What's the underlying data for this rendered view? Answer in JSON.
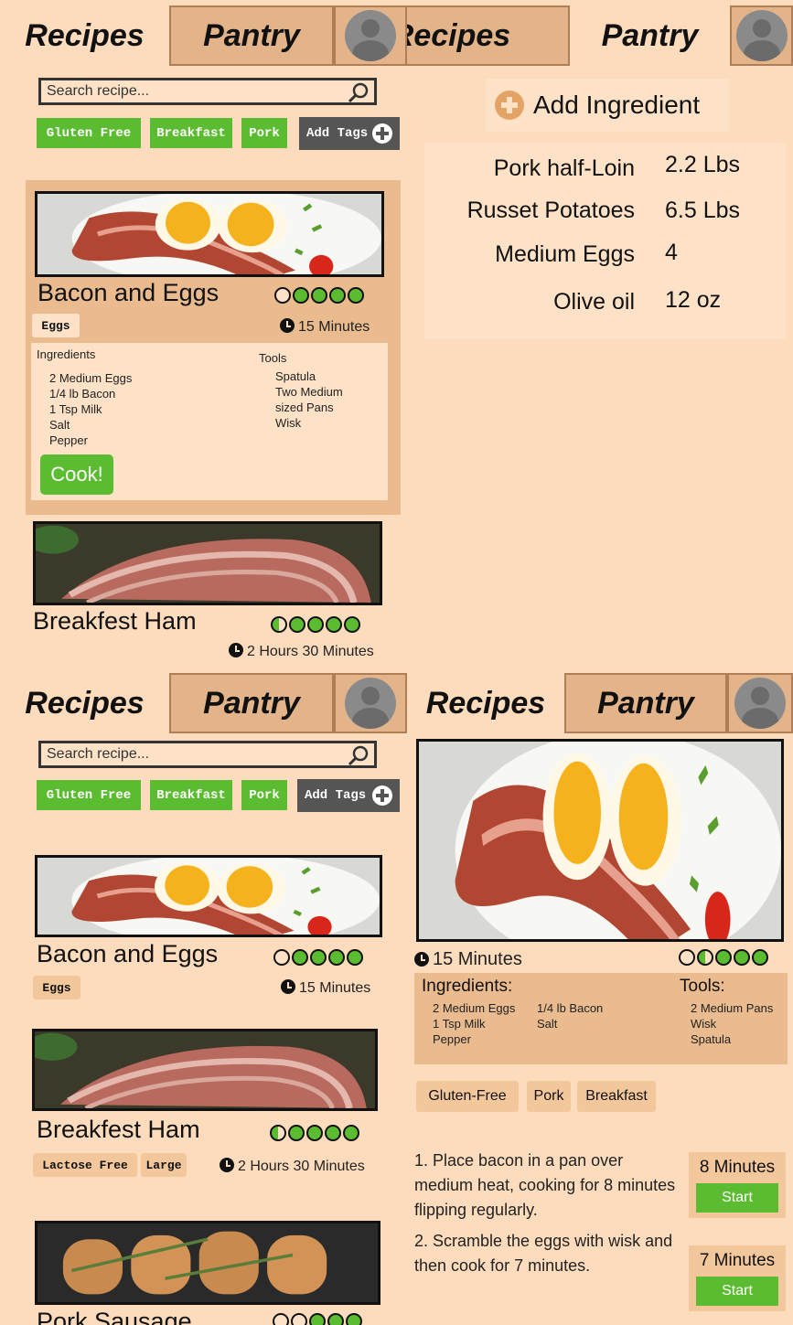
{
  "tabs": {
    "recipes": "Recipes",
    "pantry": "Pantry"
  },
  "search": {
    "placeholder": "Search recipe..."
  },
  "filter_tags": [
    "Gluten Free",
    "Breakfast",
    "Pork"
  ],
  "add_tags_label": "Add Tags",
  "cook_label": "Cook!",
  "recipes": [
    {
      "name": "Bacon and Eggs",
      "time": "15 Minutes",
      "rating_filled": 4,
      "tags": [
        "Eggs"
      ],
      "ingredients_heading": "Ingredients",
      "ingredients": [
        "2 Medium Eggs",
        "1/4 lb Bacon",
        "1 Tsp Milk",
        "Salt",
        "Pepper"
      ],
      "tools_heading": "Tools",
      "tools": [
        "Spatula",
        "Two Medium sized Pans",
        "Wisk"
      ]
    },
    {
      "name": "Breakfest Ham",
      "time": "2 Hours 30 Minutes",
      "rating_filled": 4.5,
      "tags": [
        "Lactose Free",
        "Large"
      ]
    },
    {
      "name": "Pork Sausage",
      "rating_filled": 3
    }
  ],
  "pantry": {
    "add_label": "Add Ingredient",
    "items": [
      {
        "name": "Pork half-Loin",
        "qty": "2.2 Lbs"
      },
      {
        "name": "Russet Potatoes",
        "qty": "6.5 Lbs"
      },
      {
        "name": "Medium Eggs",
        "qty": "4"
      },
      {
        "name": "Olive oil",
        "qty": "12 oz"
      }
    ]
  },
  "detail": {
    "time": "15 Minutes",
    "ingredients_heading": "Ingredients:",
    "ingredients_col1": [
      "2 Medium Eggs",
      "1 Tsp Milk",
      "Pepper"
    ],
    "ingredients_col2": [
      "1/4 lb Bacon",
      "Salt"
    ],
    "tools_heading": "Tools:",
    "tools": [
      "2 Medium Pans",
      "Wisk",
      "Spatula"
    ],
    "tags": [
      "Gluten-Free",
      "Pork",
      "Breakfast"
    ],
    "steps": [
      {
        "text": "1. Place bacon in a pan over medium heat, cooking for 8 minutes flipping regularly.",
        "timer": "8 Minutes"
      },
      {
        "text": "2. Scramble the eggs with wisk and then cook for 7 minutes.",
        "timer": "7 Minutes"
      }
    ],
    "start_label": "Start"
  },
  "colors": {
    "bg": "#fddcbd",
    "tab_inactive": "#e3b48a",
    "accent_green": "#5cbc31",
    "card": "#e9bb8e"
  }
}
